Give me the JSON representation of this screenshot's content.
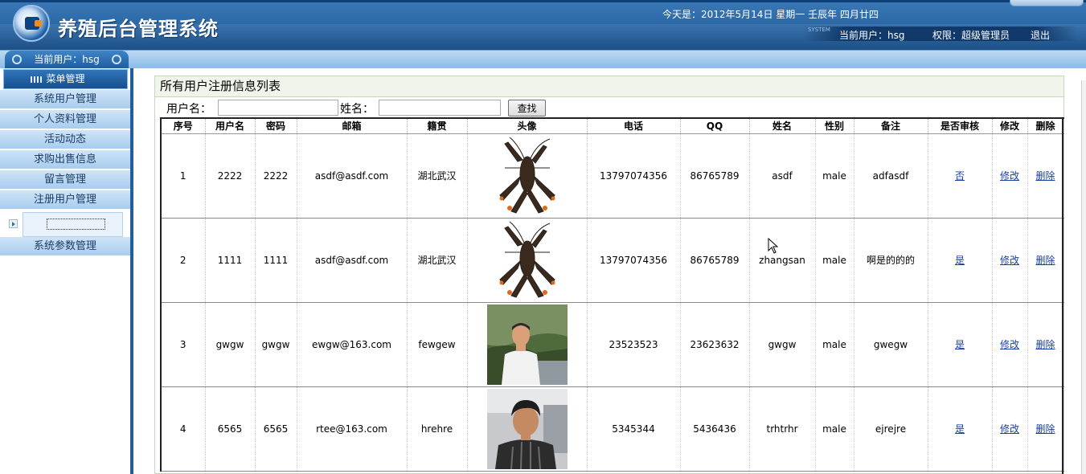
{
  "header": {
    "app_title": "养殖后台管理系统",
    "date_text": "今天是：2012年5月14日  星期一  壬辰年  四月廿四",
    "system_tag": "SYSTEM",
    "current_user_text": "当前用户：hsg",
    "permission_text": "权限：超级管理员",
    "logout_label": "退出"
  },
  "sidebar": {
    "current_user_tab": "当前用户：hsg",
    "menu_head": "菜单管理",
    "items": [
      {
        "label": "系统用户管理"
      },
      {
        "label": "个人资料管理"
      },
      {
        "label": "活动动态"
      },
      {
        "label": "求购出售信息"
      },
      {
        "label": "留言管理"
      },
      {
        "label": "注册用户管理"
      },
      {
        "label": "系统参数管理"
      }
    ]
  },
  "panel": {
    "title": "所有用户注册信息列表",
    "search": {
      "username_label": "用户名：",
      "username_value": "",
      "name_label": "姓名：",
      "name_value": "",
      "search_button": "查找"
    }
  },
  "table": {
    "columns": [
      "序号",
      "用户名",
      "密码",
      "邮箱",
      "籍贯",
      "头像",
      "电话",
      "QQ",
      "姓名",
      "性别",
      "备注",
      "是否审核",
      "修改",
      "删除"
    ],
    "rows": [
      {
        "id": "1",
        "username": "2222",
        "password": "2222",
        "email": "asdf@asdf.com",
        "hometown": "湖北武汉",
        "avatar": "lobster-image",
        "phone": "13797074356",
        "qq": "86765789",
        "name": "asdf",
        "gender": "male",
        "note": "adfasdf",
        "approved": "否",
        "edit": "修改",
        "delete": "删除"
      },
      {
        "id": "2",
        "username": "1111",
        "password": "1111",
        "email": "asdf@asdf.com",
        "hometown": "湖北武汉",
        "avatar": "lobster-image",
        "phone": "13797074356",
        "qq": "86765789",
        "name": "zhangsan",
        "gender": "male",
        "note": "啊是的的的",
        "approved": "是",
        "edit": "修改",
        "delete": "删除"
      },
      {
        "id": "3",
        "username": "gwgw",
        "password": "gwgw",
        "email": "ewgw@163.com",
        "hometown": "fewgew",
        "avatar": "older-man-photo",
        "phone": "23523523",
        "qq": "23623632",
        "name": "gwgw",
        "gender": "male",
        "note": "gwegw",
        "approved": "是",
        "edit": "修改",
        "delete": "删除"
      },
      {
        "id": "4",
        "username": "6565",
        "password": "6565",
        "email": "rtee@163.com",
        "hometown": "hrehre",
        "avatar": "young-man-photo",
        "phone": "5345344",
        "qq": "5436436",
        "name": "trhtrhr",
        "gender": "male",
        "note": "ejrejre",
        "approved": "是",
        "edit": "修改",
        "delete": "删除"
      }
    ]
  },
  "colors": {
    "header_blue": "#2a66a4",
    "menu_light_blue": "#bcd9f3",
    "link_blue": "#1a3fa1"
  }
}
